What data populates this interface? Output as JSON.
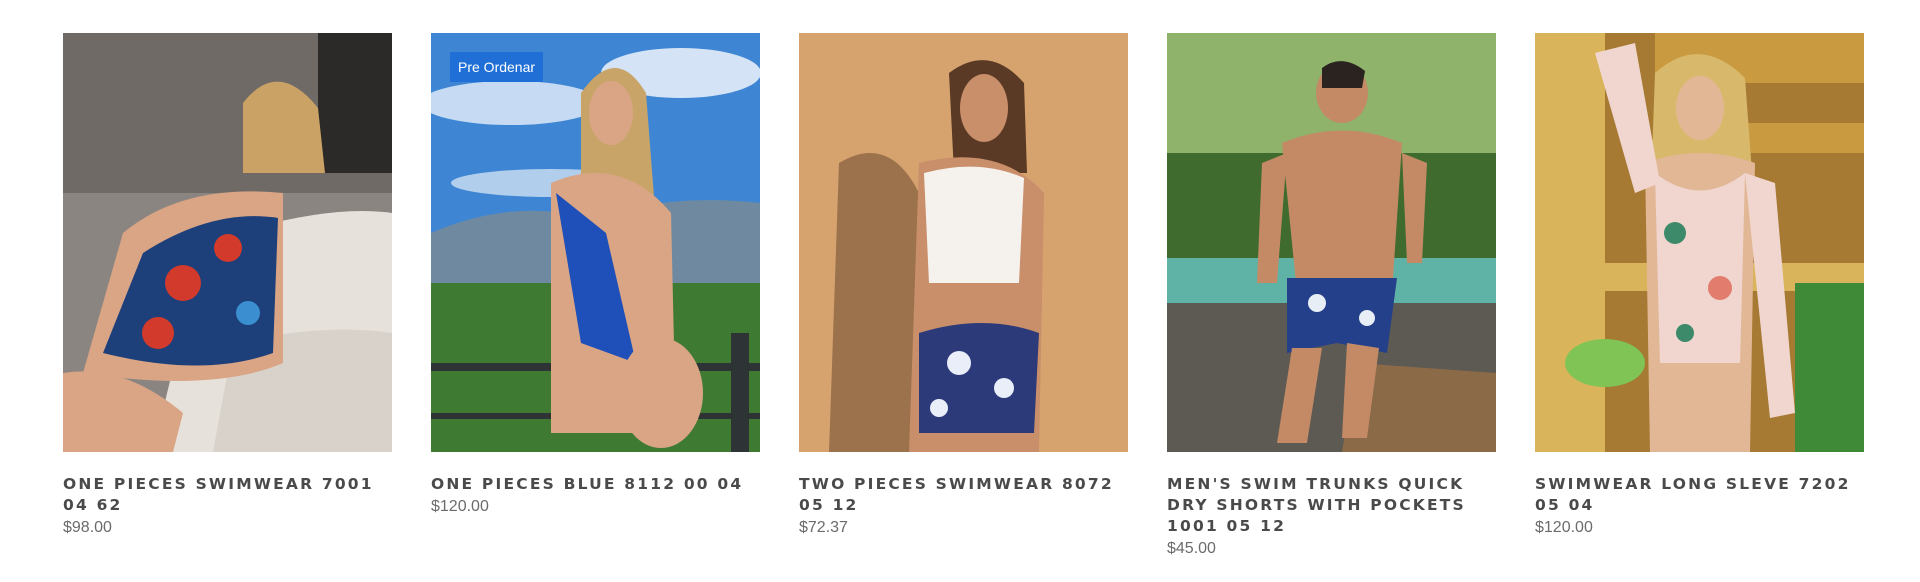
{
  "products": [
    {
      "name": "ONE PIECES SWIMWEAR 7001 04 62",
      "price": "$98.00",
      "badge": "",
      "image": "woman-floral-one-piece-on-couch"
    },
    {
      "name": "ONE PIECES BLUE 8112 00 04",
      "price": "$120.00",
      "badge": "Pre Ordenar",
      "image": "woman-blue-one-piece-balcony-mountains"
    },
    {
      "name": "TWO PIECES SWIMWEAR 8072 05 12",
      "price": "$72.37",
      "badge": "",
      "image": "woman-two-piece-tan-backdrop"
    },
    {
      "name": "MEN'S SWIM TRUNKS QUICK DRY SHORTS WITH POCKETS 1001 05 12",
      "price": "$45.00",
      "badge": "",
      "image": "man-floral-trunks-by-pool"
    },
    {
      "name": "SWIMWEAR LONG SLEVE 7202 05 04",
      "price": "$120.00",
      "badge": "",
      "image": "woman-long-sleeve-swimsuit-bamboo"
    }
  ],
  "colors": {
    "badge": "#1f6fd6",
    "title": "#4a4a4a",
    "price": "#6b6b6b"
  }
}
